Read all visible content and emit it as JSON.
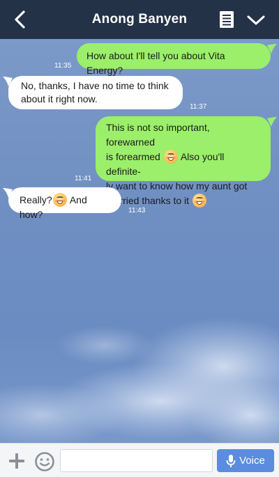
{
  "header": {
    "title": "Anong Banyen",
    "back_icon": "chevron-left-icon",
    "notes_icon": "notes-icon",
    "menu_icon": "chevron-down-icon",
    "background": "#243247"
  },
  "messages": [
    {
      "direction": "outgoing",
      "text": "How about I'll tell you about Vita Energy?",
      "time": "11:35"
    },
    {
      "direction": "incoming",
      "line1": "No, thanks, I have no time to think",
      "line2": "about it right now.",
      "time": "11:37"
    },
    {
      "direction": "outgoing",
      "line1": "This is not so important, forewarned",
      "line2a": "is forearmed",
      "line2b": "Also you'll definite-",
      "line3": "ly want to know how my aunt got",
      "line4": "married thanks to it",
      "time": "11:41"
    },
    {
      "direction": "incoming",
      "part1": "Really?",
      "part2": "And how?",
      "time": "11:43"
    }
  ],
  "composer": {
    "placeholder": "",
    "voice_label": "Voice",
    "plus_icon": "plus-icon",
    "emoji_icon": "smiley-icon",
    "mic_icon": "microphone-icon"
  },
  "colors": {
    "outgoing_bubble": "#9bef6a",
    "incoming_bubble": "#ffffff",
    "voice_button": "#5b8cdf"
  }
}
